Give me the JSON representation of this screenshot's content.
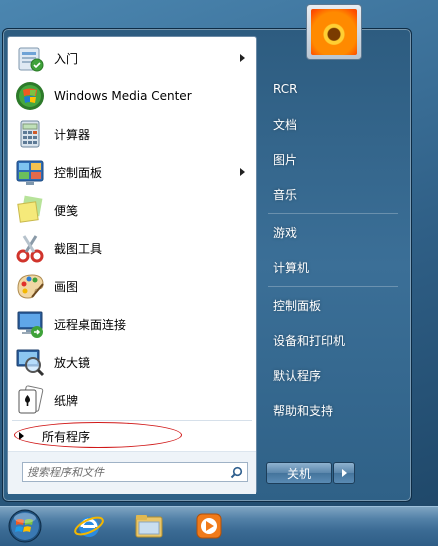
{
  "programs": [
    {
      "label": "入门",
      "icon": "getting-started-icon",
      "has_submenu": true
    },
    {
      "label": "Windows Media Center",
      "icon": "media-center-icon",
      "has_submenu": false
    },
    {
      "label": "计算器",
      "icon": "calculator-icon",
      "has_submenu": false
    },
    {
      "label": "控制面板",
      "icon": "control-panel-icon",
      "has_submenu": true
    },
    {
      "label": "便笺",
      "icon": "sticky-notes-icon",
      "has_submenu": false
    },
    {
      "label": "截图工具",
      "icon": "snipping-tool-icon",
      "has_submenu": false
    },
    {
      "label": "画图",
      "icon": "paint-icon",
      "has_submenu": false
    },
    {
      "label": "远程桌面连接",
      "icon": "remote-desktop-icon",
      "has_submenu": false
    },
    {
      "label": "放大镜",
      "icon": "magnifier-icon",
      "has_submenu": false
    },
    {
      "label": "纸牌",
      "icon": "solitaire-icon",
      "has_submenu": false
    }
  ],
  "all_programs_label": "所有程序",
  "search": {
    "placeholder": "搜索程序和文件"
  },
  "right_pane": {
    "items": [
      "RCR",
      "文档",
      "图片",
      "音乐",
      "游戏",
      "计算机",
      "控制面板",
      "设备和打印机",
      "默认程序",
      "帮助和支持"
    ]
  },
  "shutdown_label": "关机",
  "taskbar": {
    "items": [
      "start-orb-icon",
      "internet-explorer-icon",
      "windows-explorer-icon",
      "media-player-icon"
    ]
  },
  "colors": {
    "highlight_oval": "#d01818",
    "menu_blue": "#2d5c80"
  }
}
